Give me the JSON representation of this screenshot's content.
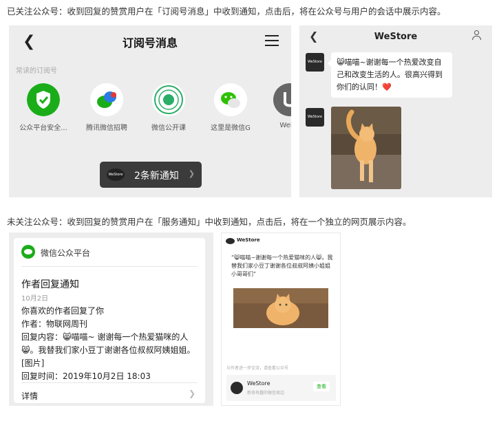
{
  "captions": {
    "followed": "已关注公众号：收到回复的赞赏用户在「订阅号消息」中收到通知，点击后，将在公众号与用户的会话中展示内容。",
    "not_followed": "未关注公众号：收到回复的赞赏用户在「服务通知」中收到通知，点击后，将在一个独立的网页展示内容。"
  },
  "subscription_screen": {
    "back_icon": "chevron-left-icon",
    "title": "订阅号消息",
    "menu_icon": "hamburger-icon",
    "section_label": "常读的订阅号",
    "accounts": [
      {
        "name": "公众平台安全...",
        "icon": "shield-check-icon",
        "color": "#1aad19"
      },
      {
        "name": "腾讯微信招聘",
        "icon": "chat-bubbles-icon",
        "color": "#2b7be4"
      },
      {
        "name": "微信公开课",
        "icon": "seal-icon",
        "color": "#2aae67"
      },
      {
        "name": "这里是微信G",
        "icon": "wechat-icon",
        "color": "#2dc100"
      },
      {
        "name": "WeDe",
        "icon": "wedesign-logo-icon",
        "color": "#555555"
      }
    ],
    "notify_text": "2条新通知"
  },
  "chat_screen": {
    "title": "WeStore",
    "message": "😸喵喵~谢谢每一个热爱改变自己和改变生活的人。很高兴得到你们的认同！❤️",
    "avatar_label": "WeStore"
  },
  "service_card": {
    "header": "微信公众平台",
    "title": "作者回复通知",
    "date": "10月2日",
    "lines": [
      "你喜欢的作者回复了你",
      "作者：物联网周刊",
      "回复内容：😸喵喵~ 谢谢每一个热爱猫咪的人😸。我替我们家小豆丁谢谢各位叔叔阿姨姐姐。[图片]",
      "回复时间：2019年10月2日 18:03"
    ],
    "detail": "详情"
  },
  "web_page": {
    "header": "WeStore",
    "quote": "“😸喵喵~谢谢每一个热爱猫咪的人😸。我替我们家小豆丁谢谢各位叔叔阿姨小姐姐小哥哥们”",
    "note": "与作者进一步交流，请查看公众号",
    "account_name": "WeStore",
    "account_desc": "新奇有趣的微信周边",
    "view_button": "查看"
  }
}
